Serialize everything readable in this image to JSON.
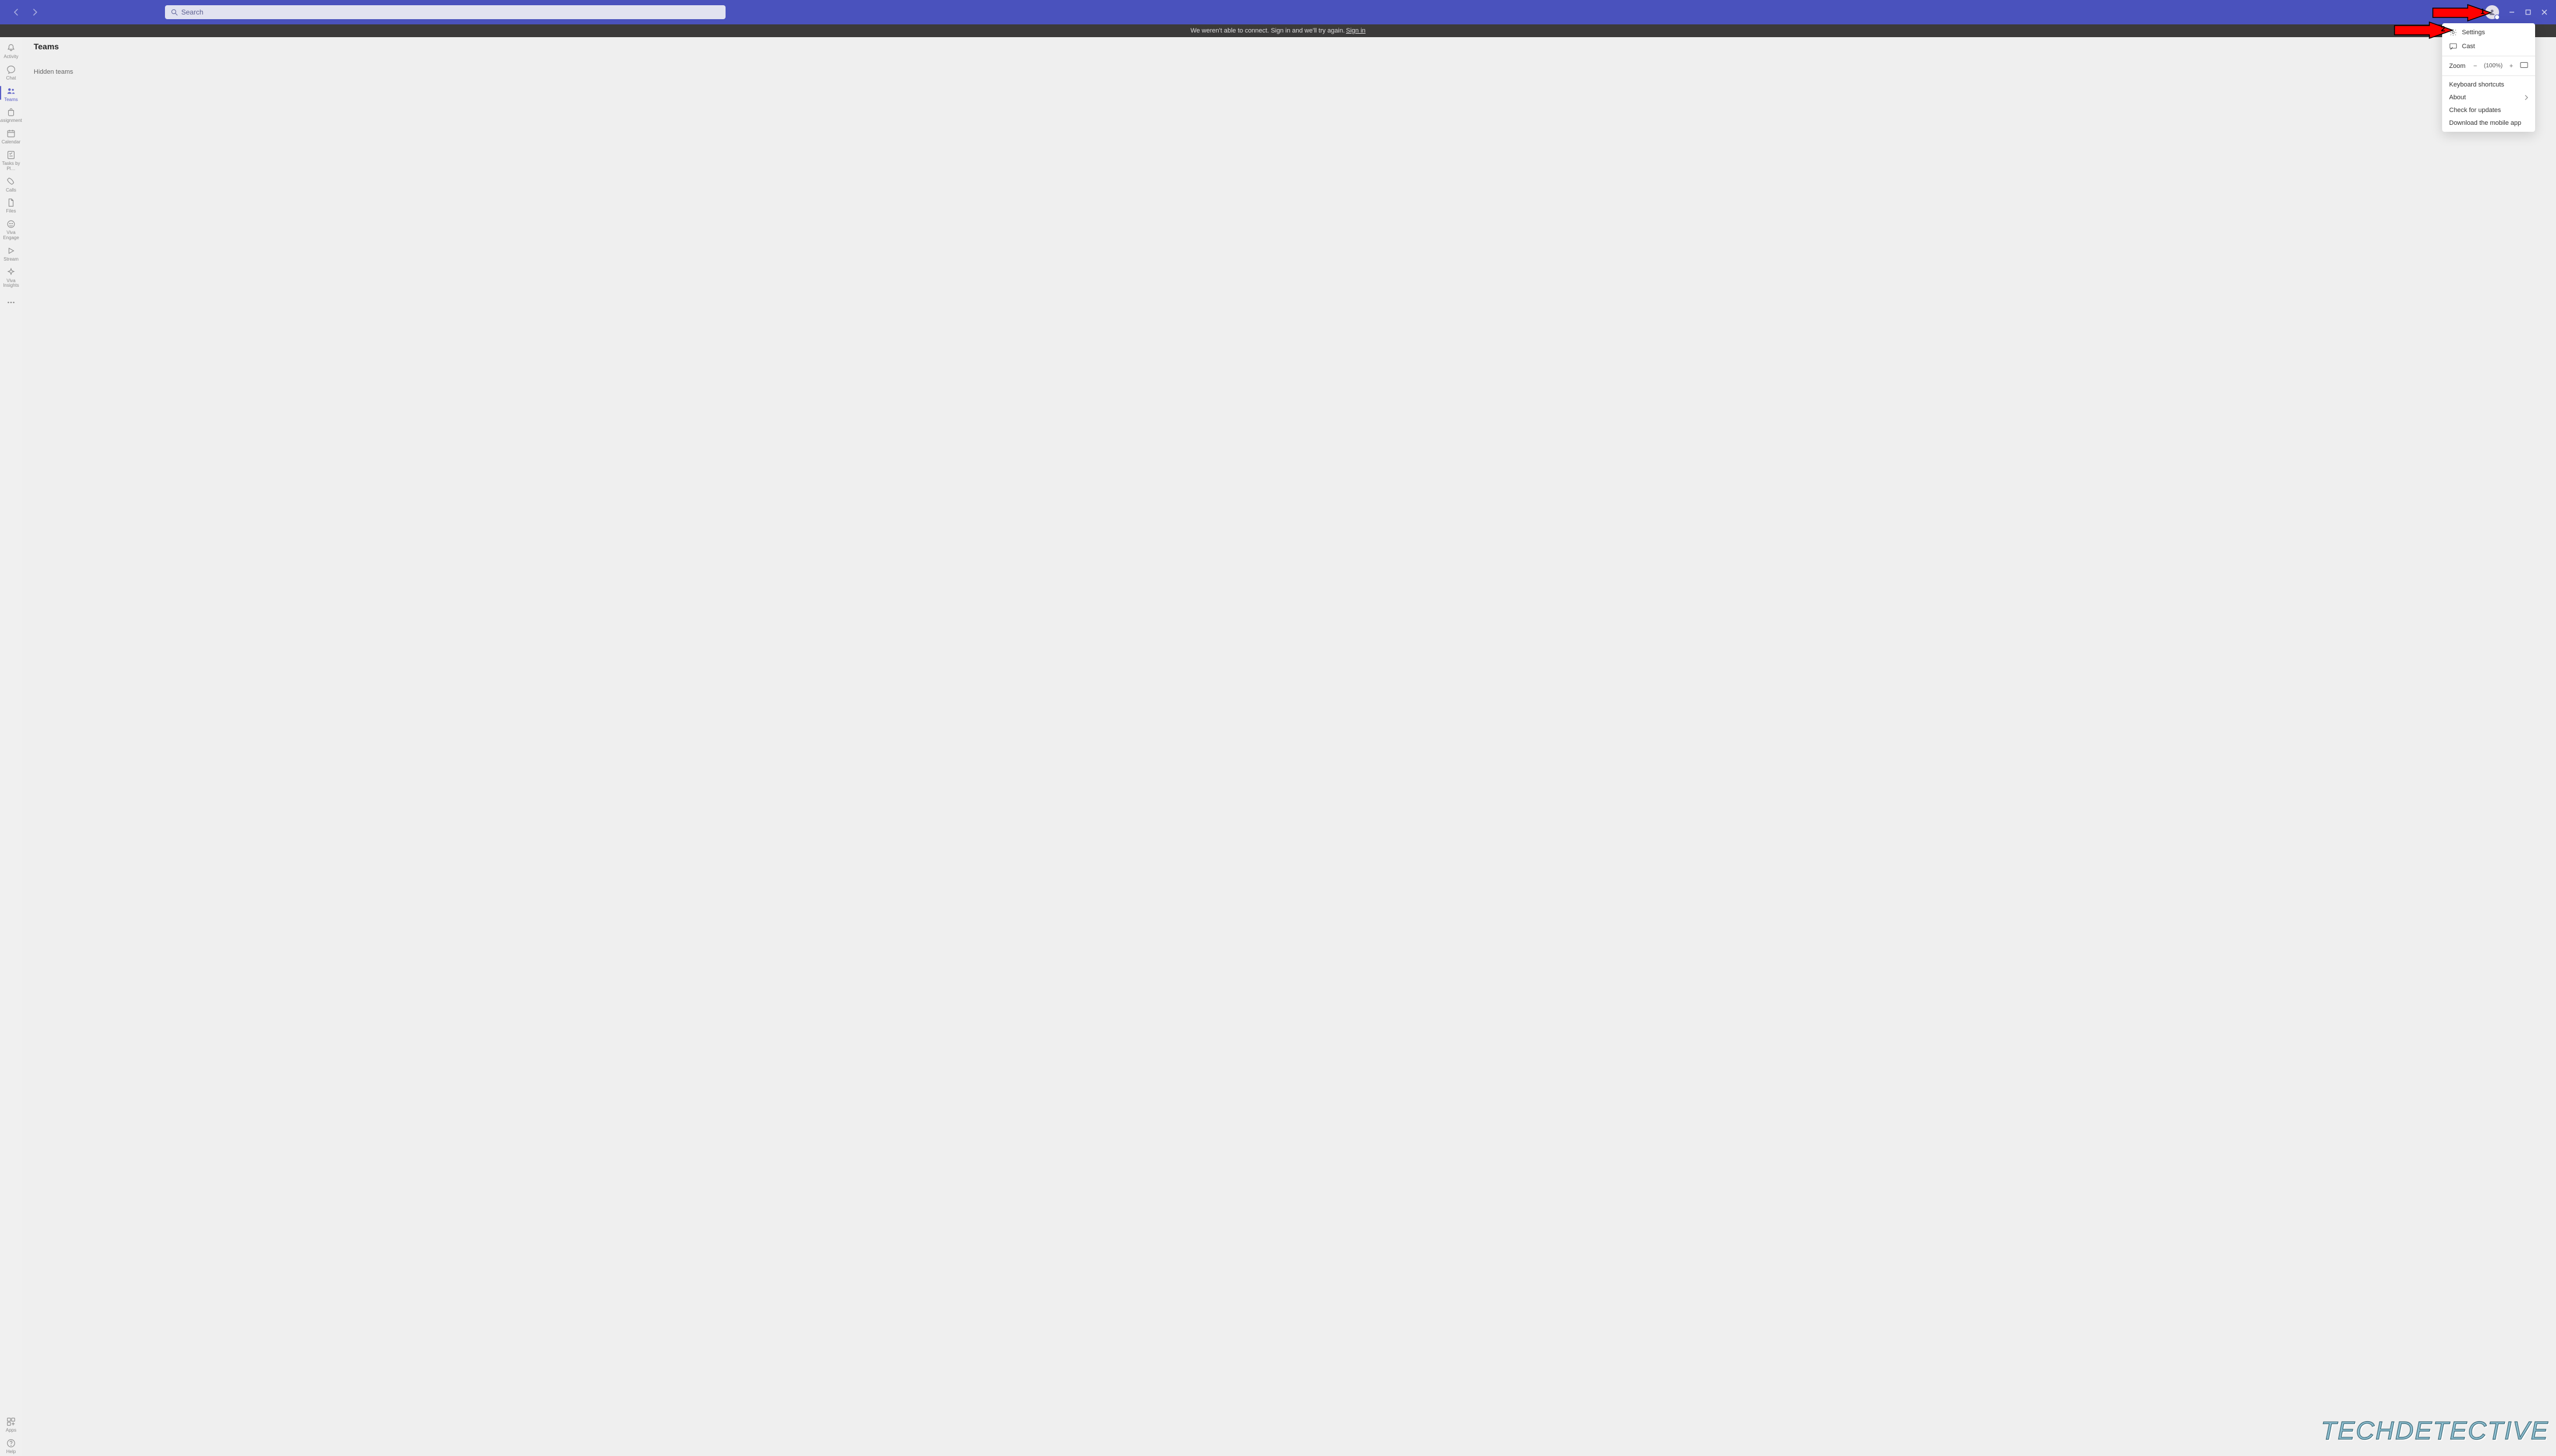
{
  "colors": {
    "titlebar": "#4a52bd",
    "accent": "#5b5fc7",
    "banner_bg": "#3b3a3a",
    "arrow_red": "#ff0000"
  },
  "titlebar": {
    "search_placeholder": "Search"
  },
  "banner": {
    "text": "We weren't able to connect. Sign in and we'll try again.",
    "link_text": "Sign in"
  },
  "apprail": {
    "items": [
      {
        "id": "activity",
        "label": "Activity",
        "active": false
      },
      {
        "id": "chat",
        "label": "Chat",
        "active": false
      },
      {
        "id": "teams",
        "label": "Teams",
        "active": true
      },
      {
        "id": "assignments",
        "label": "Assignments",
        "active": false
      },
      {
        "id": "calendar",
        "label": "Calendar",
        "active": false
      },
      {
        "id": "tasks",
        "label": "Tasks by Pl…",
        "active": false
      },
      {
        "id": "calls",
        "label": "Calls",
        "active": false
      },
      {
        "id": "files",
        "label": "Files",
        "active": false
      },
      {
        "id": "vivaengage",
        "label": "Viva Engage",
        "active": false
      },
      {
        "id": "stream",
        "label": "Stream",
        "active": false
      },
      {
        "id": "vivainsights",
        "label": "Viva Insights",
        "active": false
      }
    ],
    "bottom": [
      {
        "id": "apps",
        "label": "Apps"
      },
      {
        "id": "help",
        "label": "Help"
      }
    ]
  },
  "main": {
    "heading": "Teams",
    "subheading": "Hidden teams"
  },
  "menu": {
    "settings": "Settings",
    "cast": "Cast",
    "zoom_label": "Zoom",
    "zoom_value": "(100%)",
    "shortcuts": "Keyboard shortcuts",
    "about": "About",
    "check_updates": "Check for updates",
    "download_app": "Download the mobile app"
  },
  "annotations": {
    "arrow1": "1",
    "arrow2": "2"
  },
  "watermark": "TECHDETECTIVE"
}
